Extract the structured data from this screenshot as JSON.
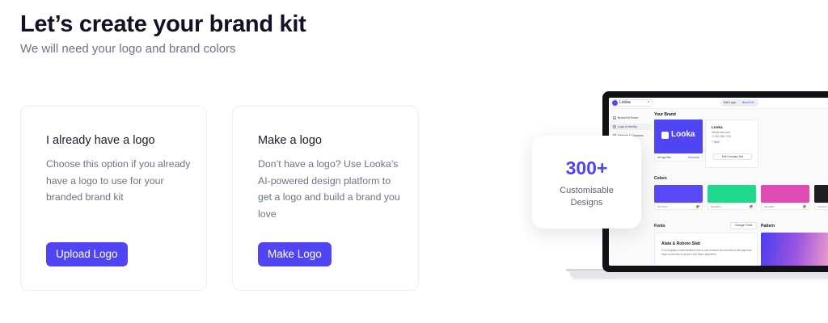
{
  "header": {
    "title": "Let’s create your brand kit",
    "subtitle": "We will need your logo and brand colors"
  },
  "options": [
    {
      "title": "I already have a logo",
      "description": "Choose this option if you already have a logo to use for your branded brand kit",
      "button": "Upload Logo"
    },
    {
      "title": "Make a logo",
      "description": "Don’t have a logo? Use Looka’s AI-powered design platform to get a logo and build a brand you love",
      "button": "Make Logo"
    }
  ],
  "stat": {
    "number": "300+",
    "label_line1": "Customisable",
    "label_line2": "Designs"
  },
  "preview": {
    "app_name": "Looka",
    "toggle": [
      "Edit Logo",
      "Brand Kit"
    ],
    "nav": [
      "Brand Kit Home",
      "Logo & Identity",
      "Website & Domains"
    ],
    "your_brand": "Your Brand",
    "brand_name": "Looka",
    "brand_foot_left": "All logo files",
    "brand_foot_right": "Download",
    "contact_name": "Looka",
    "contact_lines": [
      "info@looka.com",
      "+1 800 555 1234",
      "+ more"
    ],
    "contact_button": "Edit Company Info",
    "colors_title": "Colors",
    "colors": [
      {
        "hex": "#5A49F6",
        "label": "#5A49F6"
      },
      {
        "hex": "#1ED88C",
        "label": "#1ED88C"
      },
      {
        "hex": "#E04BB2",
        "label": "#E04BB2"
      },
      {
        "hex": "#1E1E22",
        "label": "#1E1E22"
      }
    ],
    "fonts_title": "Fonts",
    "change_fonts": "Change Fonts",
    "font_name": "Alata & Roboto Slab",
    "font_desc": "For everyday communications and to use branded documents for fast approval, easy connection to anyone and faster payments.",
    "pattern_title": "Pattern"
  },
  "colors": {
    "accent": "#5045F5",
    "heading": "#121226",
    "muted": "#6D7386"
  }
}
